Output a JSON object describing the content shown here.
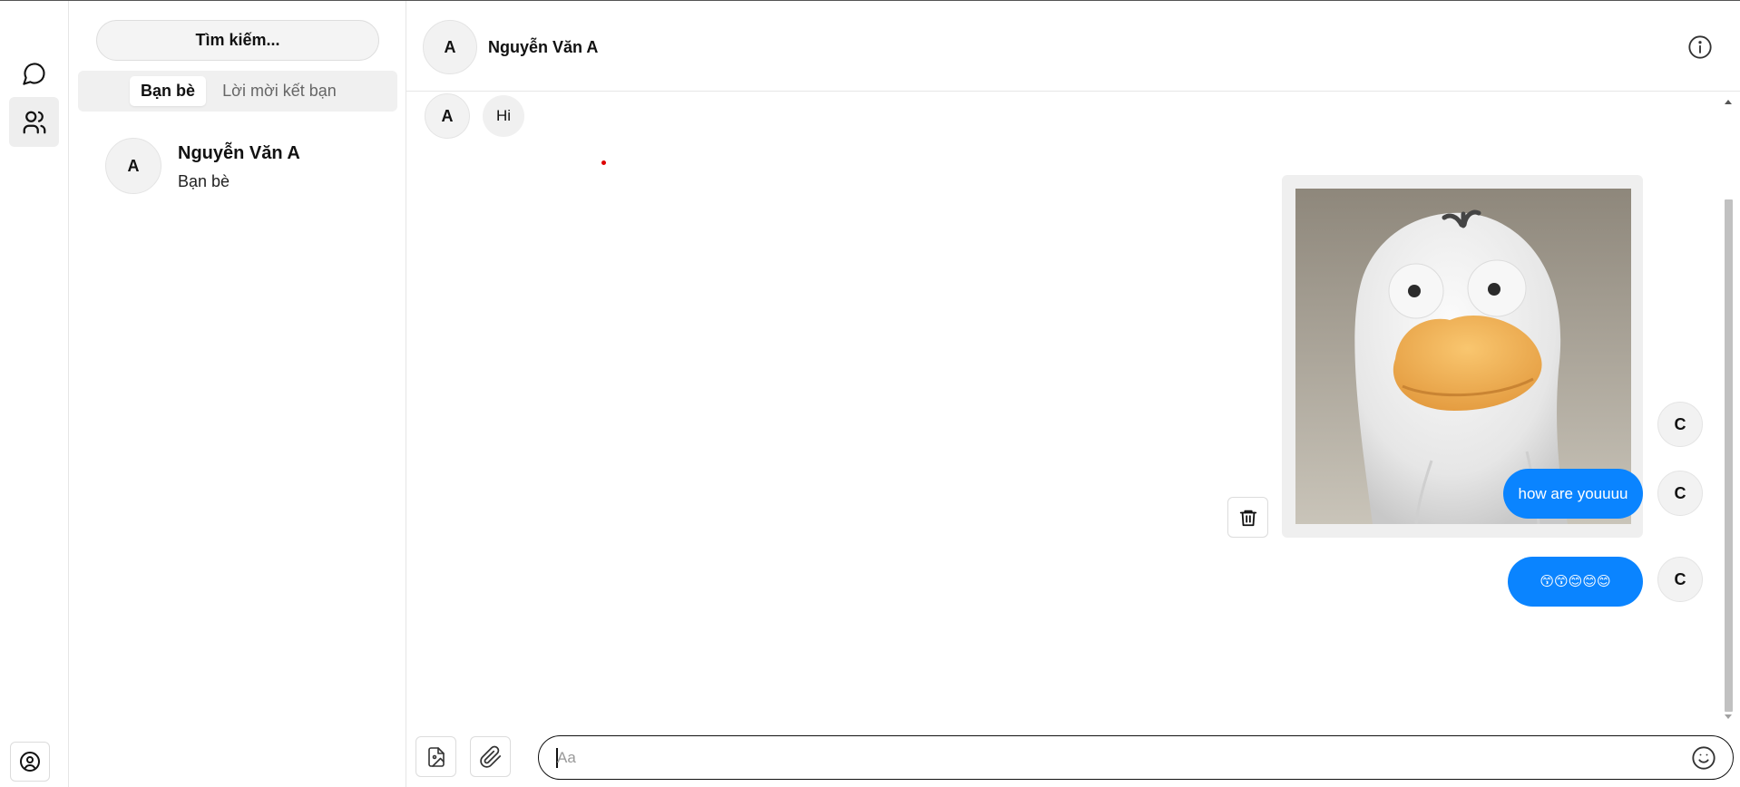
{
  "sidebar": {
    "items": [
      {
        "name": "chats",
        "icon": "chat-bubble-icon",
        "active": false
      },
      {
        "name": "friends",
        "icon": "users-icon",
        "active": true
      }
    ],
    "profile_icon": "user-circle-icon"
  },
  "friends_panel": {
    "search_label": "Tìm kiếm...",
    "tabs": [
      {
        "label": "Bạn bè",
        "active": true
      },
      {
        "label": "Lời mời kết bạn",
        "active": false
      }
    ],
    "friends": [
      {
        "avatar": "A",
        "name": "Nguyễn Văn A",
        "status": "Bạn bè"
      }
    ]
  },
  "chat": {
    "header": {
      "avatar": "A",
      "name": "Nguyễn Văn A",
      "info_icon": "info-icon"
    },
    "messages": [
      {
        "from": "other",
        "avatar": "A",
        "text": "Hi"
      },
      {
        "from": "me",
        "avatar": "C",
        "type": "image",
        "image": "white-duck-3d-figure",
        "action_icon": "trash-icon"
      },
      {
        "from": "me",
        "avatar": "C",
        "text": "how are youuuu"
      },
      {
        "from": "me",
        "avatar": "C",
        "text": "😙😙😊😊😊"
      }
    ],
    "composer": {
      "placeholder": "Aa",
      "value": "",
      "image_icon": "image-file-icon",
      "attach_icon": "paperclip-icon",
      "emoji_icon": "smiley-icon"
    }
  },
  "colors": {
    "accent": "#0a84ff",
    "bubble_in": "#f0f0f0",
    "border": "#e6e6e6"
  }
}
